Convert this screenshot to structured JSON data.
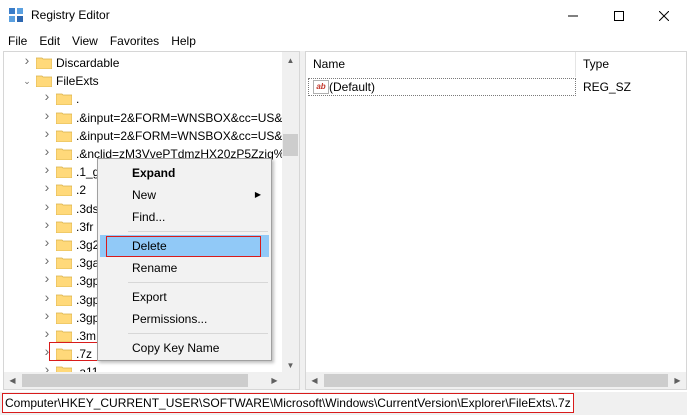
{
  "window": {
    "title": "Registry Editor"
  },
  "menu": [
    "File",
    "Edit",
    "View",
    "Favorites",
    "Help"
  ],
  "tree": [
    {
      "label": "Discardable",
      "level": 1,
      "arrow": "right"
    },
    {
      "label": "FileExts",
      "level": 1,
      "arrow": "down"
    },
    {
      "label": ".",
      "level": 2,
      "arrow": "right"
    },
    {
      "label": ".&input=2&FORM=WNSBOX&cc=US&",
      "level": 2,
      "arrow": "right"
    },
    {
      "label": ".&input=2&FORM=WNSBOX&cc=US&",
      "level": 2,
      "arrow": "right"
    },
    {
      "label": ".&nclid=zM3VvePTdmzHX20zP5Zzjg%",
      "level": 2,
      "arrow": "right"
    },
    {
      "label": ".1_g",
      "level": 2,
      "arrow": "right"
    },
    {
      "label": ".2",
      "level": 2,
      "arrow": "right"
    },
    {
      "label": ".3ds",
      "level": 2,
      "arrow": "right"
    },
    {
      "label": ".3fr",
      "level": 2,
      "arrow": "right"
    },
    {
      "label": ".3g2",
      "level": 2,
      "arrow": "right"
    },
    {
      "label": ".3ga",
      "level": 2,
      "arrow": "right"
    },
    {
      "label": ".3gp",
      "level": 2,
      "arrow": "right"
    },
    {
      "label": ".3gp",
      "level": 2,
      "arrow": "right"
    },
    {
      "label": ".3gp",
      "level": 2,
      "arrow": "right"
    },
    {
      "label": ".3m",
      "level": 2,
      "arrow": "right"
    },
    {
      "label": ".7z",
      "level": 2,
      "arrow": "right"
    },
    {
      "label": ".a11",
      "level": 2,
      "arrow": "right"
    }
  ],
  "list": {
    "columns": {
      "name": "Name",
      "type": "Type"
    },
    "rows": [
      {
        "name": "(Default)",
        "type": "REG_SZ",
        "icon": "string-value-icon"
      }
    ]
  },
  "context_menu": {
    "expand": "Expand",
    "new": "New",
    "find": "Find...",
    "delete": "Delete",
    "rename": "Rename",
    "export": "Export",
    "permissions": "Permissions...",
    "copy_key_name": "Copy Key Name"
  },
  "status": {
    "path": "Computer\\HKEY_CURRENT_USER\\SOFTWARE\\Microsoft\\Windows\\CurrentVersion\\Explorer\\FileExts\\.7z"
  },
  "colors": {
    "highlight": "#91c9f7",
    "annotation": "#d81b1b",
    "folder": "#ffd97a"
  }
}
